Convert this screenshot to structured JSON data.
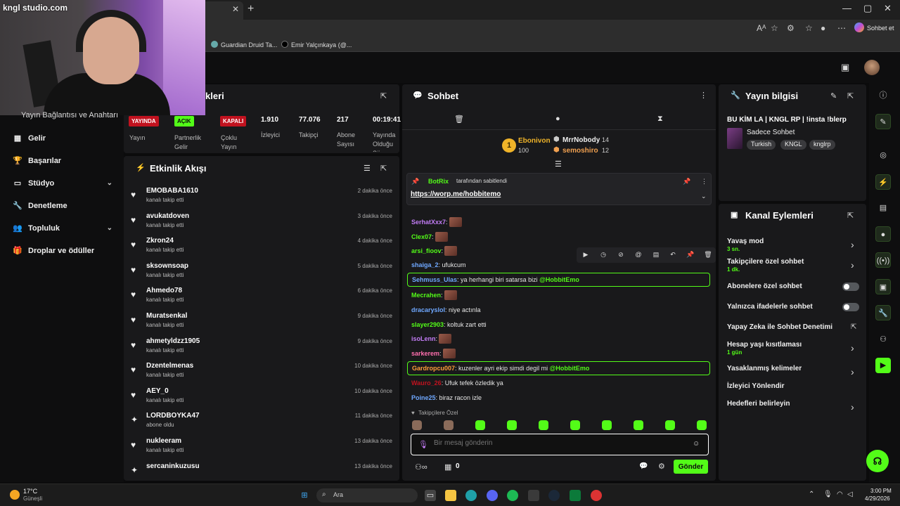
{
  "browser": {
    "tab_close": "✕",
    "new_tab": "+",
    "bookmarks": [
      "Guardian Druid Ta...",
      "Emir Yalçınkaya (@..."
    ],
    "copilot_label": "Sohbet et",
    "min": "—",
    "max": "▢",
    "close": "✕"
  },
  "webcam": {
    "title": "kngl studio.com"
  },
  "left_nav": {
    "partial_item": "Yayın Bağlantısı ve Anahtarı",
    "items": [
      {
        "icon": "▦",
        "label": "Gelir"
      },
      {
        "icon": "🏆",
        "label": "Başarılar"
      },
      {
        "icon": "▭",
        "label": "Stüdyo",
        "chevron": "⌄"
      },
      {
        "icon": "🔧",
        "label": "Denetleme"
      },
      {
        "icon": "👥",
        "label": "Topluluk",
        "chevron": "⌄"
      },
      {
        "icon": "🎁",
        "label": "Droplar ve ödüller"
      }
    ]
  },
  "stats": {
    "title_partial": "kleri",
    "items": [
      {
        "badge": "YAYINDA",
        "badge_color": "red",
        "label": "Yayın"
      },
      {
        "badge": "AÇIK",
        "badge_color": "green",
        "label": "Partnerlik Gelir"
      },
      {
        "badge": "KAPALI",
        "badge_color": "red",
        "label": "Çoklu Yayın"
      },
      {
        "value": "1.910",
        "label": "İzleyici"
      },
      {
        "value": "77.076",
        "label": "Takipçi"
      },
      {
        "value": "217",
        "label": "Abone Sayısı"
      },
      {
        "value": "00:19:41",
        "label": "Yayında Olduğu Süre"
      }
    ]
  },
  "activity": {
    "title": "Etkinlik Akışı",
    "items": [
      {
        "icon": "♥",
        "name": "EMOBABA1610",
        "action": "kanalı takip etti",
        "time": "2 dakika önce"
      },
      {
        "icon": "♥",
        "name": "avukatdoven",
        "action": "kanalı takip etti",
        "time": "3 dakika önce"
      },
      {
        "icon": "♥",
        "name": "Zkron24",
        "action": "kanalı takip etti",
        "time": "4 dakika önce"
      },
      {
        "icon": "♥",
        "name": "sksownsoap",
        "action": "kanalı takip etti",
        "time": "5 dakika önce"
      },
      {
        "icon": "♥",
        "name": "Ahmedo78",
        "action": "kanalı takip etti",
        "time": "6 dakika önce"
      },
      {
        "icon": "♥",
        "name": "Muratsenkal",
        "action": "kanalı takip etti",
        "time": "9 dakika önce"
      },
      {
        "icon": "♥",
        "name": "ahmetyldzz1905",
        "action": "kanalı takip etti",
        "time": "9 dakika önce"
      },
      {
        "icon": "♥",
        "name": "Dzentelmenas",
        "action": "kanalı takip etti",
        "time": "10 dakika önce"
      },
      {
        "icon": "♥",
        "name": "AEY_0",
        "action": "kanalı takip etti",
        "time": "10 dakika önce"
      },
      {
        "icon": "✦",
        "name": "LORDBOYKA47",
        "action": "abone oldu",
        "time": "11 dakika önce"
      },
      {
        "icon": "♥",
        "name": "nukleeram",
        "action": "kanalı takip etti",
        "time": "13 dakika önce"
      },
      {
        "icon": "✦",
        "name": "sercaninkuzusu",
        "action": "",
        "time": "13 dakika önce"
      }
    ]
  },
  "chat": {
    "title": "Sohbet",
    "leaderboard": {
      "first": {
        "rank": "1",
        "name": "Ebonivon",
        "points": "100"
      },
      "second": {
        "name": "MrrNobody",
        "points": "14"
      },
      "third": {
        "name": "semoshiro",
        "points": "12"
      }
    },
    "pinned": {
      "by": "BotRix",
      "by_suffix": "tarafından sabitlendi",
      "link": "https://worp.me/hobbitemo"
    },
    "messages": [
      {
        "user": "SerhatXxx7",
        "color": "#c27cf5",
        "text": ":",
        "emote": true
      },
      {
        "user": "Clex07",
        "color": "#53fc18",
        "text": ":",
        "emote": true
      },
      {
        "user": "arsi_fioov",
        "color": "#53fc18",
        "text": ":",
        "emote": true
      },
      {
        "user": "shaiga_2",
        "color": "#6fa8ff",
        "text": ": ufukcum"
      },
      {
        "user": "Sehmuss_Ulas",
        "color": "#6fa8ff",
        "text": ": ya herhangi biri satarsa bizi ",
        "mention": "@HobbitEmo",
        "highlight": true
      },
      {
        "user": "Mecrahen",
        "color": "#53fc18",
        "text": ":",
        "emote": true
      },
      {
        "user": "dracaryslol",
        "color": "#6fa8ff",
        "text": ": niye actınla"
      },
      {
        "user": "slayer2903",
        "color": "#53fc18",
        "text": ": koltuk zart etti"
      },
      {
        "user": "isoLenn",
        "color": "#c27cf5",
        "text": ":",
        "emote": true
      },
      {
        "user": "sarkerem",
        "color": "#ff6fae",
        "text": ":",
        "emote": true
      },
      {
        "user": "Gardropcu007",
        "color": "#ff9c3a",
        "text": ": kuzenler ayri ekip simdi degil mi ",
        "mention": "@HobbitEmo",
        "highlight": true
      },
      {
        "user": "Wauro_26",
        "color": "#c1121f",
        "text": ": Ufuk tefek özledik ya"
      },
      {
        "user": "Poine25",
        "color": "#6fa8ff",
        "text": ": biraz racon izle"
      }
    ],
    "followers_only_label": "Takipçilere Özel",
    "input_placeholder": "Bir mesaj gönderin",
    "points": "0",
    "send_label": "Gönder"
  },
  "stream_info": {
    "title": "Yayın bilgisi",
    "stream_title": "BU KİM LA | KNGL RP | !insta !blerp",
    "category": "Sadece Sohbet",
    "tags": [
      "Turkish",
      "KNGL",
      "knglrp"
    ]
  },
  "channel_actions": {
    "title": "Kanal Eylemleri",
    "items": [
      {
        "label": "Yavaş mod",
        "sub": "3 sn.",
        "control": "chevron"
      },
      {
        "label": "Takipçilere özel sohbet",
        "sub": "1 dk.",
        "control": "chevron"
      },
      {
        "label": "Abonelere özel sohbet",
        "control": "toggle"
      },
      {
        "label": "Yalnızca ifadelerle sohbet",
        "control": "toggle"
      },
      {
        "label": "Yapay Zeka ile Sohbet Denetimi",
        "control": "external"
      },
      {
        "label": "Hesap yaşı kısıtlaması",
        "sub": "1 gün",
        "control": "chevron"
      },
      {
        "label": "Yasaklanmış kelimeler",
        "control": "chevron"
      },
      {
        "label": "İzleyici Yönlendir",
        "control": "none"
      },
      {
        "label": "Hedefleri belirleyin",
        "control": "chevron"
      }
    ]
  },
  "taskbar": {
    "weather_temp": "17°C",
    "weather_desc": "Güneşli",
    "search_label": "Ara",
    "time": "3:00 PM",
    "date": "4/29/2026"
  },
  "colors": {
    "accent": "#53fc18",
    "live_red": "#c1121f",
    "panel": "#19191b"
  }
}
